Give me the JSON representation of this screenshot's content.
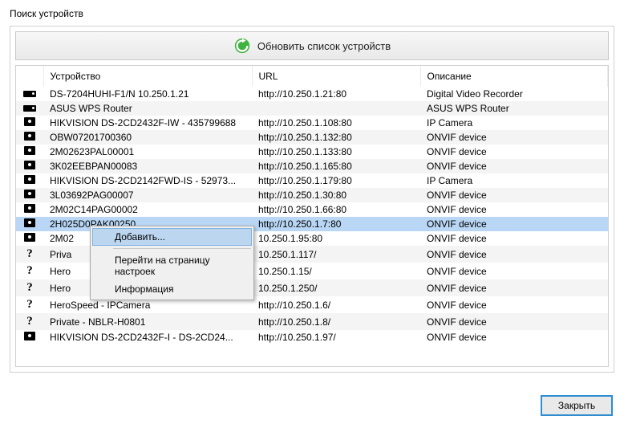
{
  "window": {
    "title": "Поиск устройств",
    "refresh_label": "Обновить список устройств",
    "close_label": "Закрыть"
  },
  "columns": {
    "device": "Устройство",
    "url": "URL",
    "description": "Описание"
  },
  "context_menu": {
    "add": "Добавить...",
    "open_settings": "Перейти на страницу настроек",
    "info": "Информация"
  },
  "rows": [
    {
      "icon": "long",
      "device": "DS-7204HUHI-F1/N 10.250.1.21",
      "url": "http://10.250.1.21:80",
      "desc": "Digital Video Recorder",
      "selected": false
    },
    {
      "icon": "long",
      "device": "ASUS WPS Router",
      "url": "",
      "desc": "ASUS WPS Router",
      "selected": false
    },
    {
      "icon": "cam",
      "device": "HIKVISION DS-2CD2432F-IW - 435799688",
      "url": "http://10.250.1.108:80",
      "desc": "IP Camera",
      "selected": false
    },
    {
      "icon": "cam",
      "device": "OBW07201700360",
      "url": "http://10.250.1.132:80",
      "desc": "ONVIF device",
      "selected": false
    },
    {
      "icon": "cam",
      "device": "2M02623PAL00001",
      "url": "http://10.250.1.133:80",
      "desc": "ONVIF device",
      "selected": false
    },
    {
      "icon": "cam",
      "device": "3K02EEBPAN00083",
      "url": "http://10.250.1.165:80",
      "desc": "ONVIF device",
      "selected": false
    },
    {
      "icon": "cam",
      "device": "HIKVISION DS-2CD2142FWD-IS - 52973...",
      "url": "http://10.250.1.179:80",
      "desc": "IP Camera",
      "selected": false
    },
    {
      "icon": "cam",
      "device": "3L03692PAG00007",
      "url": "http://10.250.1.30:80",
      "desc": "ONVIF device",
      "selected": false
    },
    {
      "icon": "cam",
      "device": "2M02C14PAG00002",
      "url": "http://10.250.1.66:80",
      "desc": "ONVIF device",
      "selected": false
    },
    {
      "icon": "cam",
      "device": "2H025D0PAK00250",
      "url": "http://10.250.1.7:80",
      "desc": "ONVIF device",
      "selected": true
    },
    {
      "icon": "cam",
      "device": "2M02",
      "url": "10.250.1.95:80",
      "desc": "ONVIF device",
      "selected": false
    },
    {
      "icon": "q",
      "device": "Priva",
      "url": "10.250.1.117/",
      "desc": "ONVIF device",
      "selected": false
    },
    {
      "icon": "q",
      "device": "Hero",
      "url": "10.250.1.15/",
      "desc": "ONVIF device",
      "selected": false
    },
    {
      "icon": "q",
      "device": "Hero",
      "url": "10.250.1.250/",
      "desc": "ONVIF device",
      "selected": false
    },
    {
      "icon": "q",
      "device": "HeroSpeed - IPCamera",
      "url": "http://10.250.1.6/",
      "desc": "ONVIF device",
      "selected": false
    },
    {
      "icon": "q",
      "device": "Private - NBLR-H0801",
      "url": "http://10.250.1.8/",
      "desc": "ONVIF device",
      "selected": false
    },
    {
      "icon": "cam",
      "device": "HIKVISION DS-2CD2432F-I - DS-2CD24...",
      "url": "http://10.250.1.97/",
      "desc": "ONVIF device",
      "selected": false
    }
  ]
}
